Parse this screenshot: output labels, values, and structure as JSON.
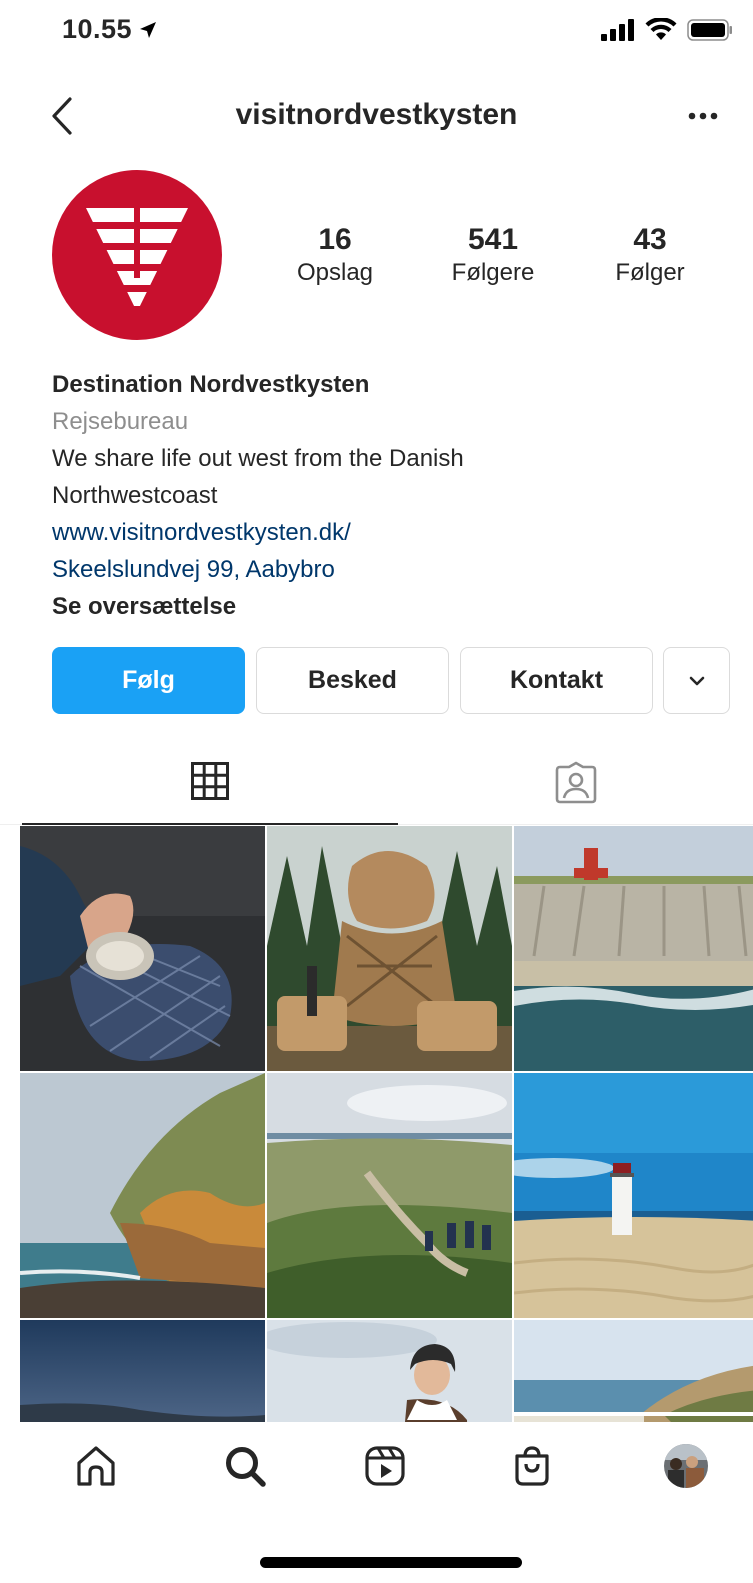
{
  "status_bar": {
    "time": "10.55"
  },
  "header": {
    "username": "visitnordvestkysten"
  },
  "stats": [
    {
      "value": "16",
      "label": "Opslag"
    },
    {
      "value": "541",
      "label": "Følgere"
    },
    {
      "value": "43",
      "label": "Følger"
    }
  ],
  "bio": {
    "name": "Destination Nordvestkysten",
    "category": "Rejsebureau",
    "text_line1": "We share life out west from the Danish",
    "text_line2": "Northwestcoast",
    "website": "www.visitnordvestkysten.dk/",
    "address": "Skeelslundvej 99, Aabybro",
    "translate": "Se oversættelse"
  },
  "actions": {
    "follow": "Følg",
    "message": "Besked",
    "contact": "Kontakt"
  },
  "colors": {
    "brand_red": "#c8102e",
    "follow_blue": "#1aa1f5",
    "link_blue": "#00376b"
  },
  "icons": {
    "tabs": [
      "grid-icon",
      "tagged-icon"
    ],
    "tabbar": [
      "home-icon",
      "search-icon",
      "reels-icon",
      "shop-icon",
      "profile-avatar"
    ]
  }
}
